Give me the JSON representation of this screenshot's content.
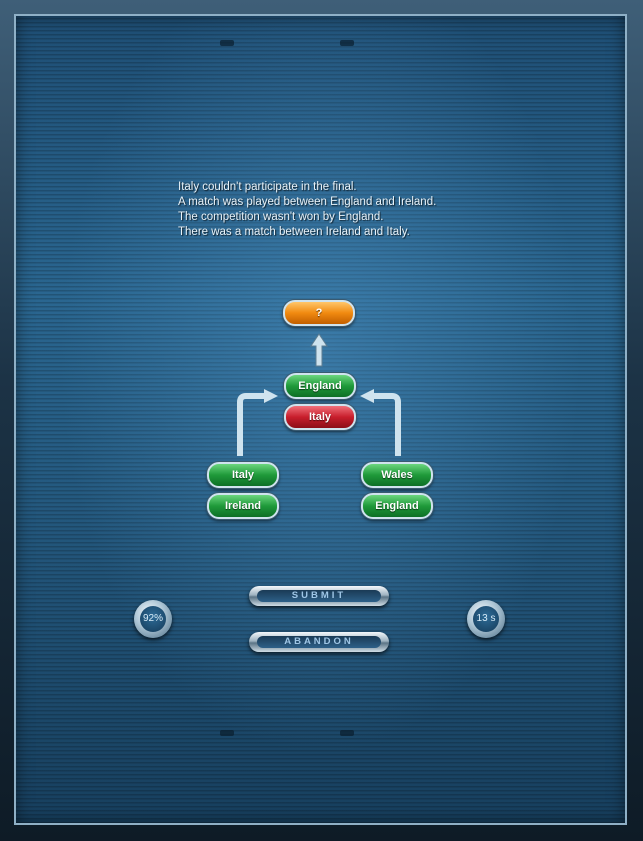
{
  "clues": [
    "Italy couldn't participate in the final.",
    "A match was played between England and Ireland.",
    "The competition wasn't won by England.",
    "There was a match between Ireland and Italy."
  ],
  "bracket": {
    "winner": {
      "label": "?",
      "color": "orange"
    },
    "final": [
      {
        "label": "England",
        "color": "green"
      },
      {
        "label": "Italy",
        "color": "red"
      }
    ],
    "left_semi": [
      {
        "label": "Italy",
        "color": "green"
      },
      {
        "label": "Ireland",
        "color": "green"
      }
    ],
    "right_semi": [
      {
        "label": "Wales",
        "color": "green"
      },
      {
        "label": "England",
        "color": "green"
      }
    ]
  },
  "buttons": {
    "submit": "SUBMIT",
    "abandon": "ABANDON"
  },
  "gauges": {
    "percent": "92%",
    "timer": "13 s"
  },
  "colors": {
    "green": "#1f9a3a",
    "red": "#c81e2c",
    "orange": "#f18a10",
    "board": "#24597f"
  }
}
